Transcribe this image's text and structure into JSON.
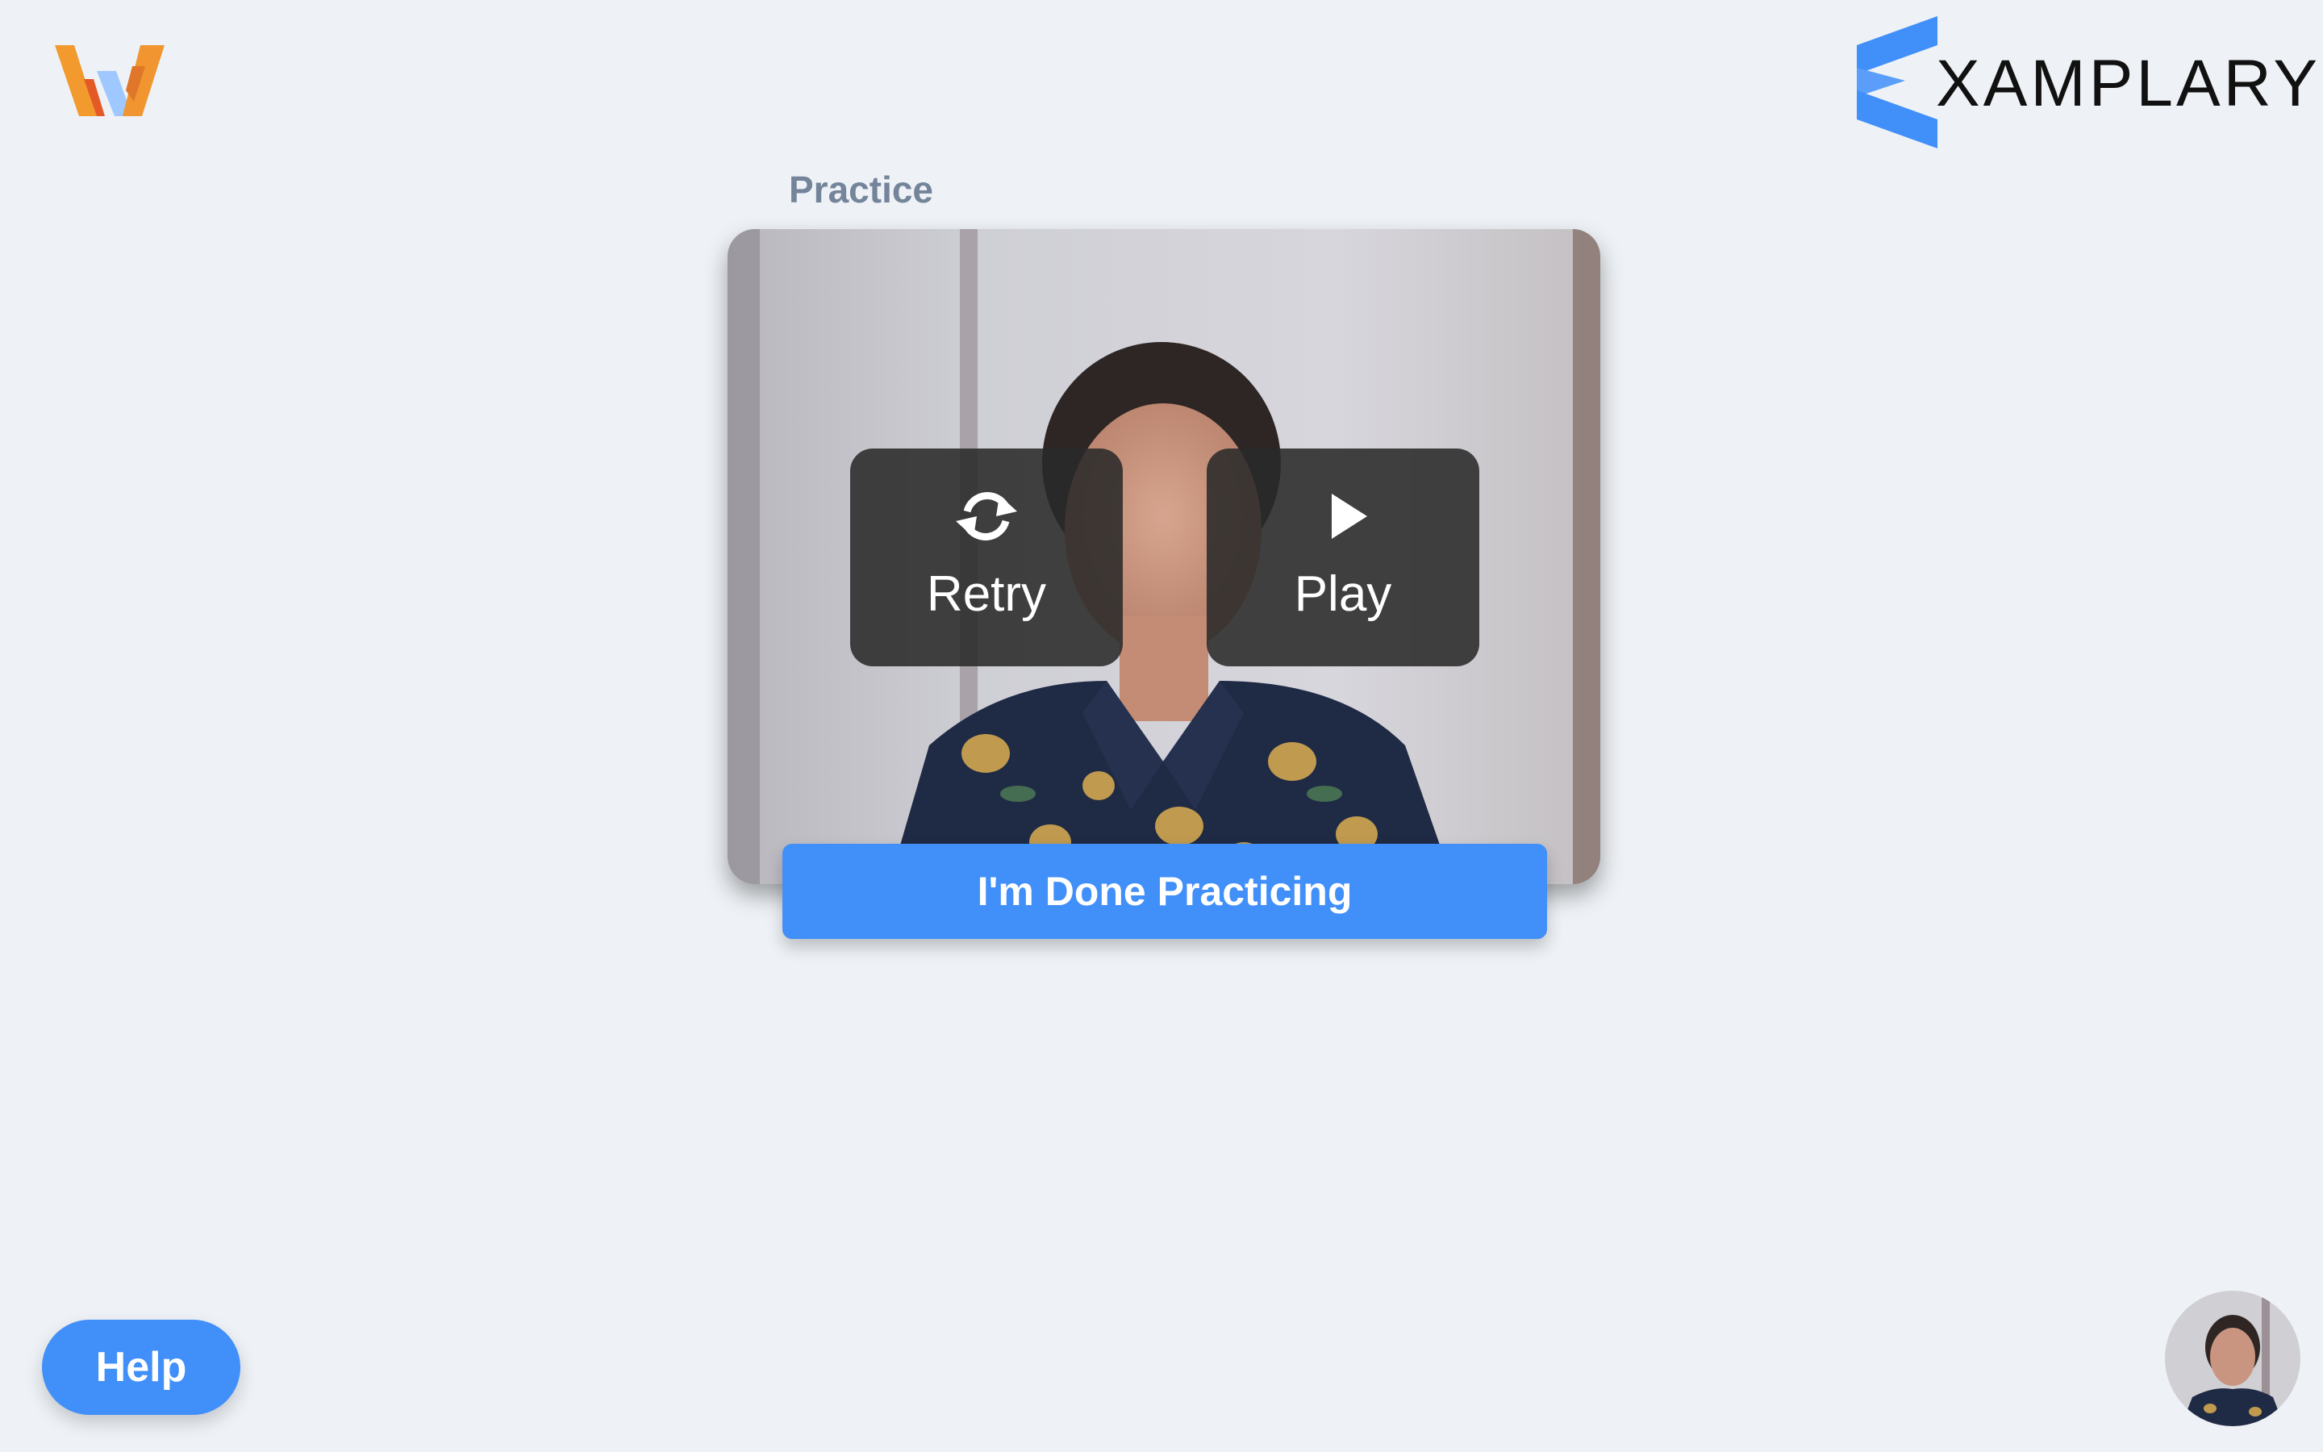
{
  "header": {
    "left_logo_icon": "w-logo-icon",
    "right_logo": {
      "icon": "xamplary-mark-icon",
      "text": "XAMPLARY",
      "color": "#418ff9"
    }
  },
  "practice": {
    "title": "Practice",
    "video": {
      "retry_label": "Retry",
      "retry_icon": "refresh-icon",
      "play_label": "Play",
      "play_icon": "play-icon"
    },
    "done_button_label": "I'm Done Practicing"
  },
  "footer": {
    "help_label": "Help",
    "avatar_icon": "user-camera-avatar"
  },
  "colors": {
    "background": "#eef2f6",
    "primary": "#418ff9",
    "section_title": "#74849a",
    "overlay": "#2a2a2a"
  }
}
